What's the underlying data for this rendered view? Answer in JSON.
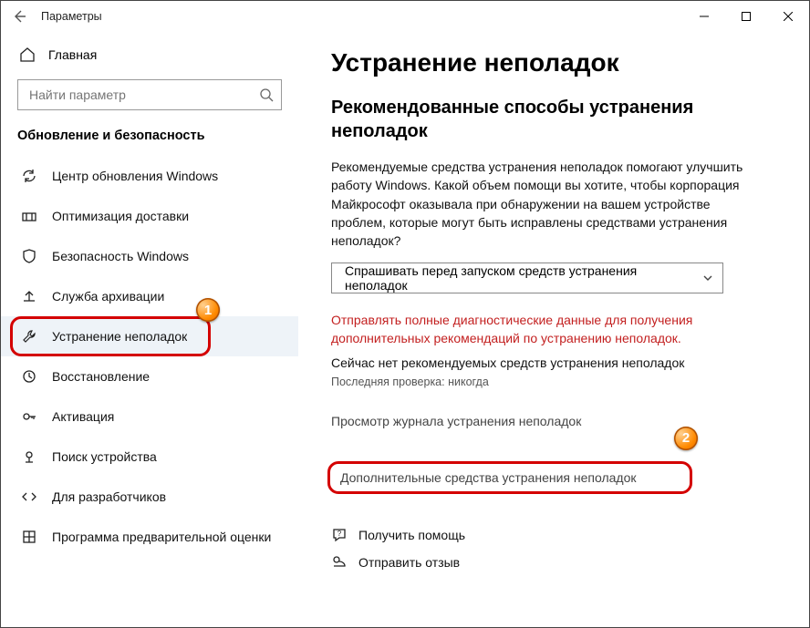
{
  "window": {
    "title": "Параметры"
  },
  "sidebar": {
    "home": "Главная",
    "search_placeholder": "Найти параметр",
    "section": "Обновление и безопасность",
    "items": [
      {
        "label": "Центр обновления Windows",
        "icon": "sync-icon"
      },
      {
        "label": "Оптимизация доставки",
        "icon": "delivery-icon"
      },
      {
        "label": "Безопасность Windows",
        "icon": "shield-icon"
      },
      {
        "label": "Служба архивации",
        "icon": "backup-icon"
      },
      {
        "label": "Устранение неполадок",
        "icon": "wrench-icon"
      },
      {
        "label": "Восстановление",
        "icon": "recovery-icon"
      },
      {
        "label": "Активация",
        "icon": "activation-icon"
      },
      {
        "label": "Поиск устройства",
        "icon": "find-device-icon"
      },
      {
        "label": "Для разработчиков",
        "icon": "developers-icon"
      },
      {
        "label": "Программа предварительной оценки",
        "icon": "insider-icon"
      }
    ]
  },
  "main": {
    "h1": "Устранение неполадок",
    "h2": "Рекомендованные способы устранения неполадок",
    "desc": "Рекомендуемые средства устранения неполадок помогают улучшить работу Windows. Какой объем помощи вы хотите, чтобы корпорация Майкрософт оказывала при обнаружении на вашем устройстве проблем, которые могут быть исправлены средствами устранения неполадок?",
    "dropdown_value": "Спрашивать перед запуском средств устранения неполадок",
    "red_link": "Отправлять полные диагностические данные для получения дополнительных рекомендаций по устранению неполадок.",
    "status": "Сейчас нет рекомендуемых средств устранения неполадок",
    "last_check": "Последняя проверка: никогда",
    "history_link": "Просмотр журнала устранения неполадок",
    "more_link": "Дополнительные средства устранения неполадок",
    "help": "Получить помощь",
    "feedback": "Отправить отзыв"
  },
  "annotations": {
    "badge1": "1",
    "badge2": "2"
  }
}
